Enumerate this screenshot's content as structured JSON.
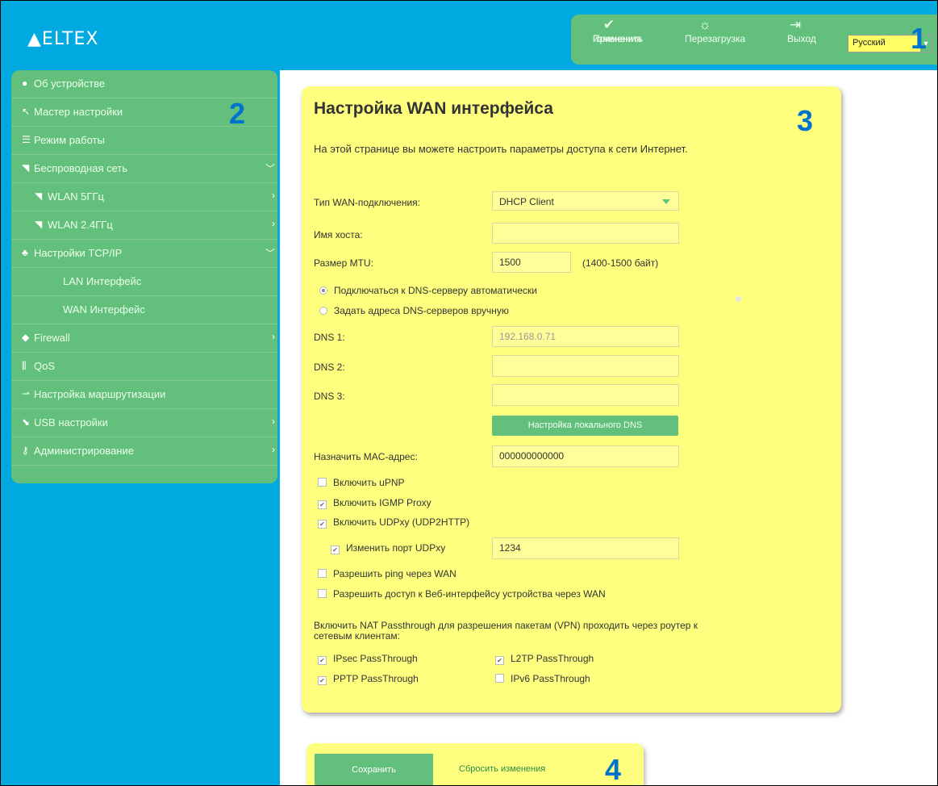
{
  "header": {
    "logo": "ELTEX",
    "apply_label": "Применить изменения",
    "apply_line1": "Применить",
    "apply_line2": "изменения",
    "reboot_label": "Перезагрузка",
    "logout_label": "Выход",
    "language": "Русский"
  },
  "annotations": [
    "1",
    "2",
    "3",
    "4"
  ],
  "sidebar": {
    "items": [
      {
        "label": "Об устройстве",
        "icon": "globe-icon"
      },
      {
        "label": "Мастер настройки",
        "icon": "wand-icon"
      },
      {
        "label": "Режим работы",
        "icon": "list-icon"
      },
      {
        "label": "Беспроводная сеть",
        "icon": "wifi-icon",
        "chevron": "down"
      },
      {
        "label": "WLAN 5ГГц",
        "icon": "wifi-icon",
        "chevron": "right"
      },
      {
        "label": "WLAN 2.4ГГц",
        "icon": "wifi-icon",
        "chevron": "right"
      },
      {
        "label": "Настройки TCP/IP",
        "icon": "network-icon",
        "chevron": "down"
      },
      {
        "label": "LAN Интерфейс"
      },
      {
        "label": "WAN Интерфейс"
      },
      {
        "label": "Firewall",
        "icon": "shield-icon",
        "chevron": "right"
      },
      {
        "label": "QoS",
        "icon": "sliders-icon"
      },
      {
        "label": "Настройка маршрутизации",
        "icon": "route-icon"
      },
      {
        "label": "USB настройки",
        "icon": "usb-icon",
        "chevron": "right"
      },
      {
        "label": "Администрирование",
        "icon": "key-icon",
        "chevron": "right"
      }
    ]
  },
  "main": {
    "title": "Настройка WAN интерфейса",
    "description": "На этой странице вы можете настроить параметры доступа к сети Интернет.",
    "wan_type_label": "Тип WAN-подключения:",
    "wan_type_value": "DHCP Client",
    "hostname_label": "Имя хоста:",
    "hostname_value": "",
    "mtu_label": "Размер MTU:",
    "mtu_value": "1500",
    "mtu_hint": "(1400-1500 байт)",
    "dns_auto_label": "Подключаться к DNS-серверу автоматически",
    "dns_manual_label": "Задать адреса DNS-серверов вручную",
    "dns1_label": "DNS 1:",
    "dns1_value": "192.168.0.71",
    "dns2_label": "DNS 2:",
    "dns2_value": "",
    "dns3_label": "DNS 3:",
    "dns3_value": "",
    "local_dns_button": "Настройка локального DNS",
    "mac_label": "Назначить MAC-адрес:",
    "mac_value": "000000000000",
    "upnp_label": "Включить uPNP",
    "igmp_label": "Включить IGMP Proxy",
    "udpxy_label": "Включить UDPxy (UDP2HTTP)",
    "udpxy_port_label": "Изменить порт UDPxy",
    "udpxy_port_value": "1234",
    "ping_wan_label": "Разрешить ping через WAN",
    "web_wan_label": "Разрешить доступ к Веб-интерфейсу устройства через WAN",
    "nat_line1": "Включить NAT Passthrough для разрешения пакетам (VPN) проходить через роутер к",
    "nat_line2": "сетевым клиентам:",
    "ipsec_label": "IPsec PassThrough",
    "l2tp_label": "L2TP PassThrough",
    "pptp_label": "PPTP PassThrough",
    "ipv6_label": "IPv6 PassThrough",
    "checks": {
      "upnp": false,
      "igmp": true,
      "udpxy": true,
      "udpxy_port": true,
      "ping_wan": false,
      "web_wan": false,
      "ipsec": true,
      "l2tp": true,
      "pptp": true,
      "ipv6": false
    },
    "dns_mode": "auto"
  },
  "footer": {
    "save_label": "Сохранить",
    "reset_label": "Сбросить изменения"
  },
  "colors": {
    "header_blue": "#00a9df",
    "green": "#63c07c",
    "panel_yellow": "#ffff7f",
    "annotation_blue": "#0073cf"
  }
}
